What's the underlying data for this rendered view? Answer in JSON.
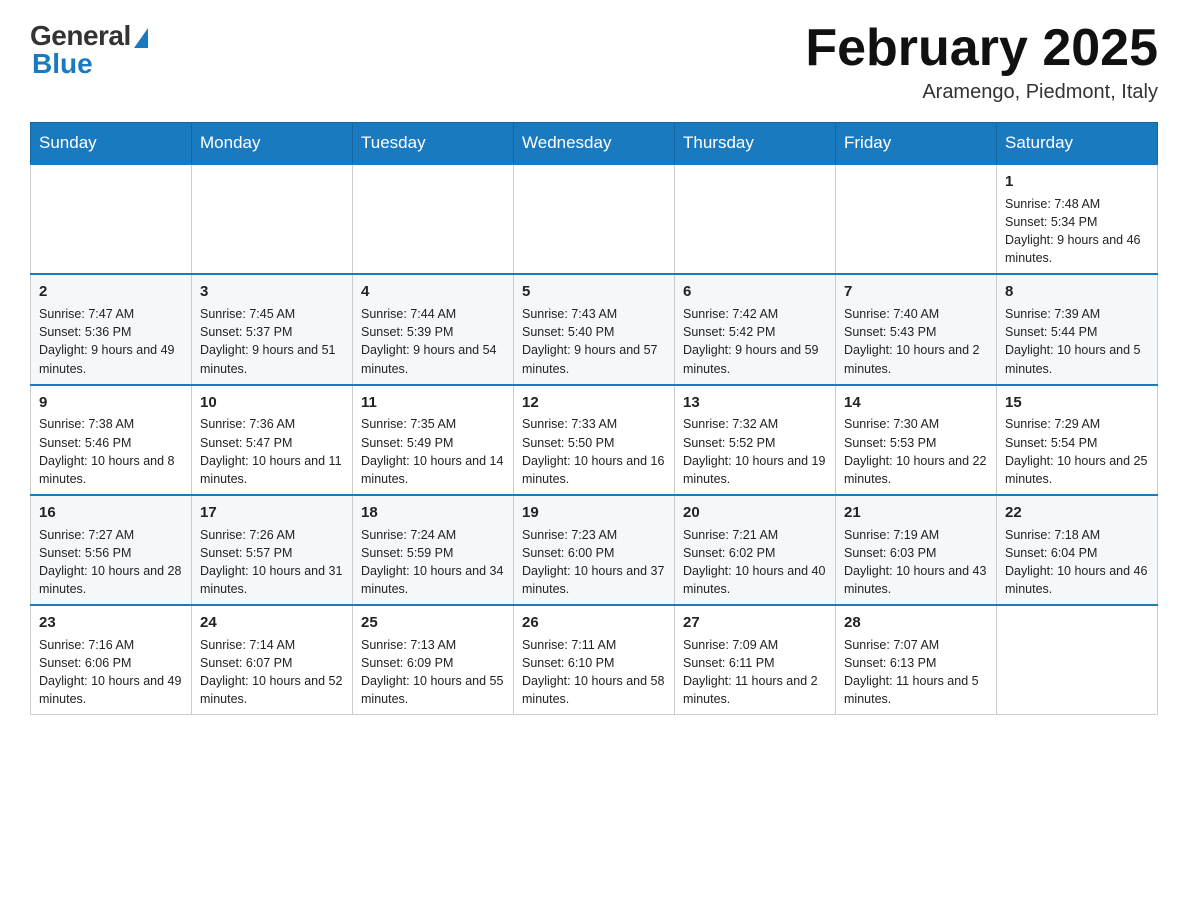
{
  "header": {
    "logo_general": "General",
    "logo_blue": "Blue",
    "month_title": "February 2025",
    "location": "Aramengo, Piedmont, Italy"
  },
  "days_of_week": [
    "Sunday",
    "Monday",
    "Tuesday",
    "Wednesday",
    "Thursday",
    "Friday",
    "Saturday"
  ],
  "weeks": [
    [
      {
        "day": "",
        "info": ""
      },
      {
        "day": "",
        "info": ""
      },
      {
        "day": "",
        "info": ""
      },
      {
        "day": "",
        "info": ""
      },
      {
        "day": "",
        "info": ""
      },
      {
        "day": "",
        "info": ""
      },
      {
        "day": "1",
        "info": "Sunrise: 7:48 AM\nSunset: 5:34 PM\nDaylight: 9 hours and 46 minutes."
      }
    ],
    [
      {
        "day": "2",
        "info": "Sunrise: 7:47 AM\nSunset: 5:36 PM\nDaylight: 9 hours and 49 minutes."
      },
      {
        "day": "3",
        "info": "Sunrise: 7:45 AM\nSunset: 5:37 PM\nDaylight: 9 hours and 51 minutes."
      },
      {
        "day": "4",
        "info": "Sunrise: 7:44 AM\nSunset: 5:39 PM\nDaylight: 9 hours and 54 minutes."
      },
      {
        "day": "5",
        "info": "Sunrise: 7:43 AM\nSunset: 5:40 PM\nDaylight: 9 hours and 57 minutes."
      },
      {
        "day": "6",
        "info": "Sunrise: 7:42 AM\nSunset: 5:42 PM\nDaylight: 9 hours and 59 minutes."
      },
      {
        "day": "7",
        "info": "Sunrise: 7:40 AM\nSunset: 5:43 PM\nDaylight: 10 hours and 2 minutes."
      },
      {
        "day": "8",
        "info": "Sunrise: 7:39 AM\nSunset: 5:44 PM\nDaylight: 10 hours and 5 minutes."
      }
    ],
    [
      {
        "day": "9",
        "info": "Sunrise: 7:38 AM\nSunset: 5:46 PM\nDaylight: 10 hours and 8 minutes."
      },
      {
        "day": "10",
        "info": "Sunrise: 7:36 AM\nSunset: 5:47 PM\nDaylight: 10 hours and 11 minutes."
      },
      {
        "day": "11",
        "info": "Sunrise: 7:35 AM\nSunset: 5:49 PM\nDaylight: 10 hours and 14 minutes."
      },
      {
        "day": "12",
        "info": "Sunrise: 7:33 AM\nSunset: 5:50 PM\nDaylight: 10 hours and 16 minutes."
      },
      {
        "day": "13",
        "info": "Sunrise: 7:32 AM\nSunset: 5:52 PM\nDaylight: 10 hours and 19 minutes."
      },
      {
        "day": "14",
        "info": "Sunrise: 7:30 AM\nSunset: 5:53 PM\nDaylight: 10 hours and 22 minutes."
      },
      {
        "day": "15",
        "info": "Sunrise: 7:29 AM\nSunset: 5:54 PM\nDaylight: 10 hours and 25 minutes."
      }
    ],
    [
      {
        "day": "16",
        "info": "Sunrise: 7:27 AM\nSunset: 5:56 PM\nDaylight: 10 hours and 28 minutes."
      },
      {
        "day": "17",
        "info": "Sunrise: 7:26 AM\nSunset: 5:57 PM\nDaylight: 10 hours and 31 minutes."
      },
      {
        "day": "18",
        "info": "Sunrise: 7:24 AM\nSunset: 5:59 PM\nDaylight: 10 hours and 34 minutes."
      },
      {
        "day": "19",
        "info": "Sunrise: 7:23 AM\nSunset: 6:00 PM\nDaylight: 10 hours and 37 minutes."
      },
      {
        "day": "20",
        "info": "Sunrise: 7:21 AM\nSunset: 6:02 PM\nDaylight: 10 hours and 40 minutes."
      },
      {
        "day": "21",
        "info": "Sunrise: 7:19 AM\nSunset: 6:03 PM\nDaylight: 10 hours and 43 minutes."
      },
      {
        "day": "22",
        "info": "Sunrise: 7:18 AM\nSunset: 6:04 PM\nDaylight: 10 hours and 46 minutes."
      }
    ],
    [
      {
        "day": "23",
        "info": "Sunrise: 7:16 AM\nSunset: 6:06 PM\nDaylight: 10 hours and 49 minutes."
      },
      {
        "day": "24",
        "info": "Sunrise: 7:14 AM\nSunset: 6:07 PM\nDaylight: 10 hours and 52 minutes."
      },
      {
        "day": "25",
        "info": "Sunrise: 7:13 AM\nSunset: 6:09 PM\nDaylight: 10 hours and 55 minutes."
      },
      {
        "day": "26",
        "info": "Sunrise: 7:11 AM\nSunset: 6:10 PM\nDaylight: 10 hours and 58 minutes."
      },
      {
        "day": "27",
        "info": "Sunrise: 7:09 AM\nSunset: 6:11 PM\nDaylight: 11 hours and 2 minutes."
      },
      {
        "day": "28",
        "info": "Sunrise: 7:07 AM\nSunset: 6:13 PM\nDaylight: 11 hours and 5 minutes."
      },
      {
        "day": "",
        "info": ""
      }
    ]
  ]
}
